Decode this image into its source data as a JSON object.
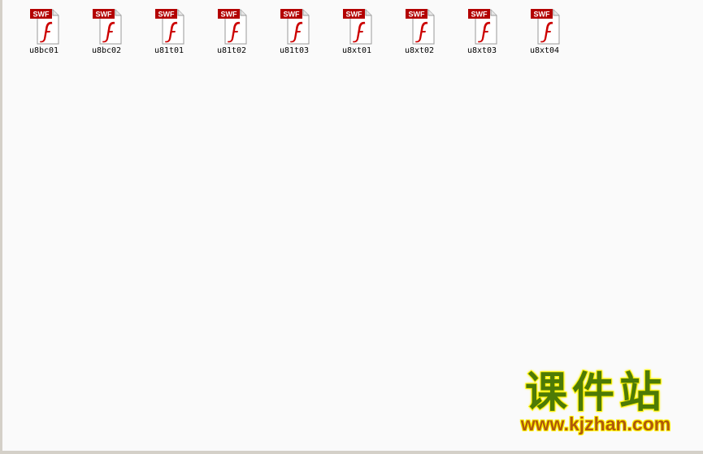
{
  "files": [
    {
      "name": "u8bc01",
      "badge": "SWF"
    },
    {
      "name": "u8bc02",
      "badge": "SWF"
    },
    {
      "name": "u81t01",
      "badge": "SWF"
    },
    {
      "name": "u81t02",
      "badge": "SWF"
    },
    {
      "name": "u81t03",
      "badge": "SWF"
    },
    {
      "name": "u8xt01",
      "badge": "SWF"
    },
    {
      "name": "u8xt02",
      "badge": "SWF"
    },
    {
      "name": "u8xt03",
      "badge": "SWF"
    },
    {
      "name": "u8xt04",
      "badge": "SWF"
    }
  ],
  "icon": {
    "type": "swf-file-icon",
    "badge_color": "#b30000",
    "glyph_color": "#cc0000"
  },
  "watermark": {
    "title": "课件站",
    "url": "www.kjzhan.com"
  }
}
